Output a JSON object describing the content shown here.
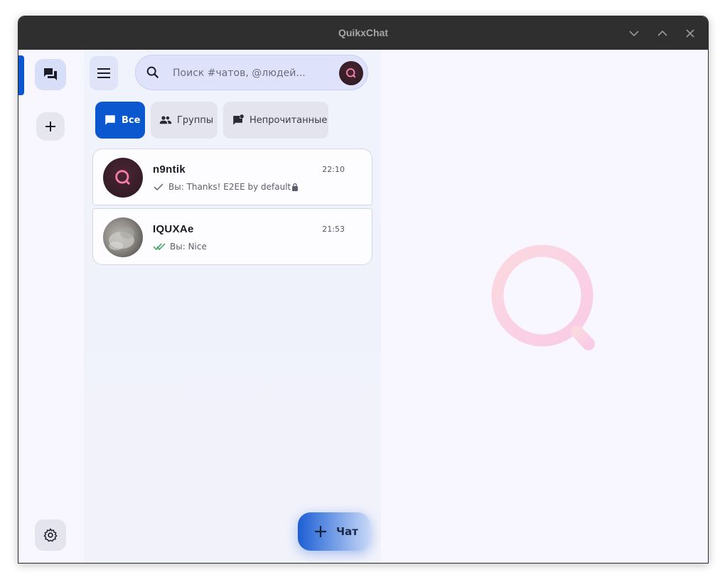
{
  "window": {
    "title": "QuikxChat",
    "controls": [
      "minimize",
      "maximize",
      "close"
    ]
  },
  "rail": {
    "items": [
      {
        "name": "chats",
        "icon": "chat-bubbles-icon",
        "active": true
      },
      {
        "name": "add",
        "icon": "plus-icon"
      },
      {
        "name": "settings",
        "icon": "gear-icon"
      }
    ]
  },
  "search": {
    "placeholder": "Поиск #чатов, @людей...",
    "value": ""
  },
  "filters": [
    {
      "label": "Все",
      "icon": "chat-icon",
      "active": true
    },
    {
      "label": "Группы",
      "icon": "group-icon",
      "active": false
    },
    {
      "label": "Непрочитанные",
      "icon": "unread-icon",
      "active": false
    }
  ],
  "chats": [
    {
      "name": "n9ntik",
      "time": "22:10",
      "preview": "Вы: Thanks! E2EE by default",
      "status": "sent",
      "encrypted": true
    },
    {
      "name": "IQUXAe",
      "time": "21:53",
      "preview": "Вы: Nice",
      "status": "read",
      "encrypted": false
    }
  ],
  "fab": {
    "label": "Чат",
    "icon": "plus-icon"
  },
  "colors": {
    "accent": "#0b57d0",
    "titlebar": "#2f2f2f",
    "logo_pink": "#f9c8dc",
    "read_check": "#2e9e4f"
  }
}
